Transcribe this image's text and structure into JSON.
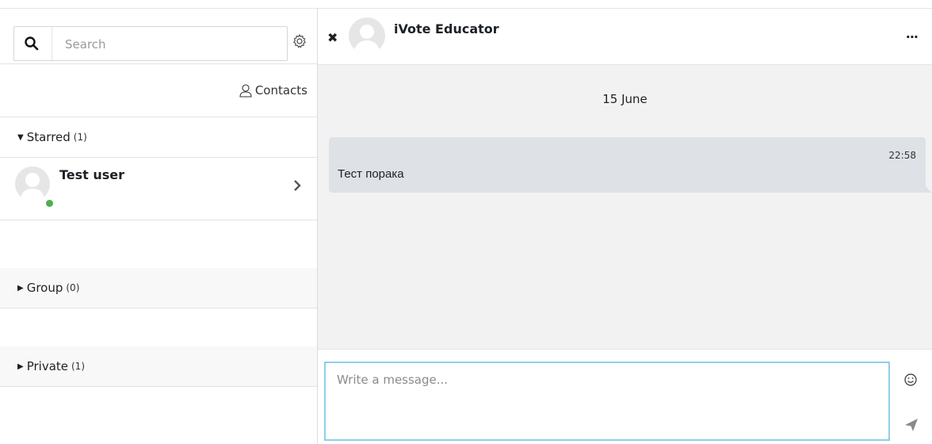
{
  "sidebar": {
    "search_placeholder": "Search",
    "contacts_label": "Contacts",
    "sections": {
      "starred": {
        "label": "Starred",
        "count": "(1)"
      },
      "group": {
        "label": "Group",
        "count": "(0)"
      },
      "private": {
        "label": "Private",
        "count": "(1)"
      }
    },
    "starred_items": [
      {
        "name": "Test user",
        "status": "online"
      }
    ]
  },
  "chat": {
    "header_name": "iVote Educator",
    "more_label": "...",
    "date_label": "15 June",
    "messages": [
      {
        "time": "22:58",
        "text": "Тест порака"
      }
    ],
    "composer_placeholder": "Write a message..."
  },
  "icons": {
    "search": "search-icon",
    "settings": "gear-icon",
    "contacts": "user-icon",
    "close": "close-icon",
    "more": "ellipsis-icon",
    "emoji": "smile-icon",
    "send": "send-icon",
    "chevron": "chevron-right-icon"
  },
  "colors": {
    "online": "#4caf50",
    "bubble": "#dee2e6",
    "focus_border": "#8ecfe8"
  }
}
